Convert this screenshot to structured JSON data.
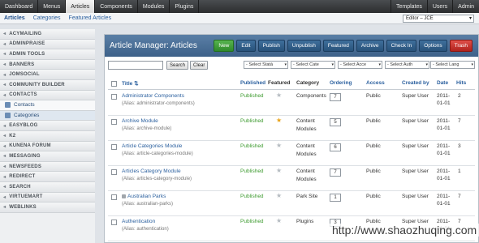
{
  "top_tabs": [
    "Dashboard",
    "Menus",
    "Articles",
    "Components",
    "Modules",
    "Plugins"
  ],
  "top_active_index": 2,
  "top_right_tabs": [
    "Templates",
    "Users",
    "Admin"
  ],
  "sub_links": [
    "Articles",
    "Categories",
    "Featured Articles"
  ],
  "sub_active_index": 0,
  "editor_select": "Editor – JCE",
  "sidebar": [
    {
      "type": "group",
      "label": "ACYMAILING"
    },
    {
      "type": "group",
      "label": "ADMINPRAISE"
    },
    {
      "type": "group",
      "label": "ADMIN TOOLS"
    },
    {
      "type": "group",
      "label": "BANNERS"
    },
    {
      "type": "group",
      "label": "JOMSOCIAL"
    },
    {
      "type": "group",
      "label": "COMMUNITY BUILDER"
    },
    {
      "type": "group",
      "label": "CONTACTS"
    },
    {
      "type": "sub",
      "label": "Contacts"
    },
    {
      "type": "sub",
      "label": "Categories",
      "active": true
    },
    {
      "type": "group",
      "label": "EASYBLOG"
    },
    {
      "type": "group",
      "label": "K2"
    },
    {
      "type": "group",
      "label": "KUNENA FORUM"
    },
    {
      "type": "group",
      "label": "MESSAGING"
    },
    {
      "type": "group",
      "label": "NEWSFEEDS"
    },
    {
      "type": "group",
      "label": "REDIRECT"
    },
    {
      "type": "group",
      "label": "SEARCH"
    },
    {
      "type": "group",
      "label": "VIRTUEMART"
    },
    {
      "type": "group",
      "label": "WEBLINKS"
    }
  ],
  "panel": {
    "title": "Article Manager: Articles",
    "toolbar": [
      "New",
      "Edit",
      "Publish",
      "Unpublish",
      "Featured",
      "Archive",
      "Check In",
      "Options",
      "Trash"
    ]
  },
  "filters": {
    "search_button": "Search",
    "clear_button": "Clear",
    "selects": [
      "- Select Statà",
      "- Select Cate",
      "- Select Acce",
      "- Select Auth",
      "- Select Lang"
    ]
  },
  "columns": [
    "Title",
    "Published",
    "Featured",
    "Category",
    "Ordering",
    "Access",
    "Created by",
    "Date",
    "Hits"
  ],
  "rows": [
    {
      "title": "Administrator Components",
      "alias": "(Alias: administrator-components)",
      "published": "Published",
      "featured": false,
      "category": [
        "Components"
      ],
      "ordering": "7",
      "access": "Public",
      "created_by": "Super User",
      "date": [
        "2011-",
        "01-01"
      ],
      "hits": "2",
      "locked": false
    },
    {
      "title": "Archive Module",
      "alias": "(Alias: archive-module)",
      "published": "Published",
      "featured": true,
      "category": [
        "Content",
        "Modules"
      ],
      "ordering": "5",
      "access": "Public",
      "created_by": "Super User",
      "date": [
        "2011-",
        "01-01"
      ],
      "hits": "7",
      "locked": false
    },
    {
      "title": "Article Categories Module",
      "alias": "(Alias: article-categories-module)",
      "published": "Published",
      "featured": false,
      "category": [
        "Content",
        "Modules"
      ],
      "ordering": "6",
      "access": "Public",
      "created_by": "Super User",
      "date": [
        "2011-",
        "01-01"
      ],
      "hits": "3",
      "locked": false
    },
    {
      "title": "Articles Category Module",
      "alias": "(Alias: articles-category-module)",
      "published": "Published",
      "featured": false,
      "category": [
        "Content",
        "Modules"
      ],
      "ordering": "7",
      "access": "Public",
      "created_by": "Super User",
      "date": [
        "2011-",
        "01-01"
      ],
      "hits": "1",
      "locked": false
    },
    {
      "title": "Australian Parks",
      "alias": "(Alias: australian-parks)",
      "published": "Published",
      "featured": false,
      "category": [
        "Park Site"
      ],
      "ordering": "1",
      "access": "Public",
      "created_by": "Super User",
      "date": [
        "2011-",
        "01-01"
      ],
      "hits": "7",
      "locked": true
    },
    {
      "title": "Authentication",
      "alias": "(Alias: authentication)",
      "published": "Published",
      "featured": false,
      "category": [
        "Plugins"
      ],
      "ordering": "3",
      "access": "Public",
      "created_by": "Super User",
      "date": [
        "2011-",
        "01-01"
      ],
      "hits": "7",
      "locked": false
    }
  ],
  "watermark": "http://www.shaozhuqing.com",
  "colors": {
    "accent": "#3d6189",
    "published": "#3c9a2e",
    "new_button": "#2f8a2a",
    "trash_button": "#b0221c"
  }
}
